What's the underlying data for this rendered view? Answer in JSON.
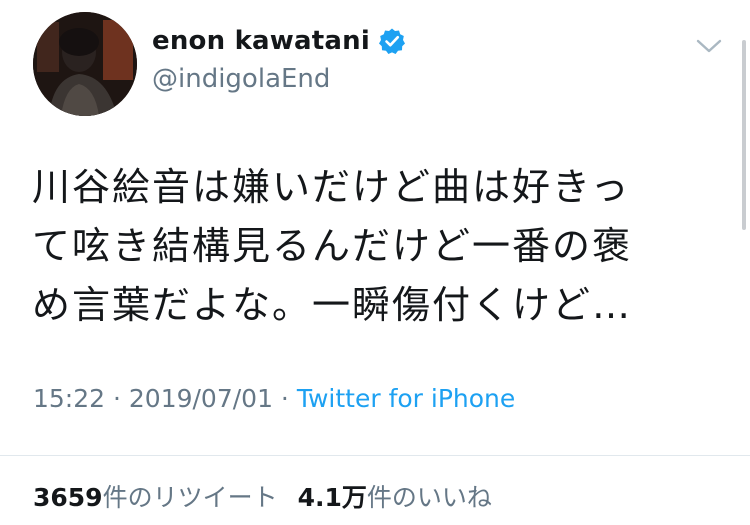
{
  "author": {
    "display_name": "enon kawatani",
    "handle": "@indigolaEnd",
    "verified": true,
    "avatar": "profile-photo"
  },
  "tweet": {
    "text": "川谷絵音は嫌いだけど曲は好きっ\nて呟き結構見るんだけど一番の褒\nめ言葉だよな。一瞬傷付くけど…"
  },
  "meta": {
    "time": "15:22",
    "separator1": " · ",
    "date": "2019/07/01",
    "separator2": " · ",
    "source": "Twitter for iPhone"
  },
  "stats": {
    "retweets_count": "3659",
    "retweets_label": "件のリツイート",
    "likes_count": "4.1万",
    "likes_label": "件のいいね"
  },
  "icons": {
    "menu": "chevron-down-icon",
    "verified": "verified-badge-icon"
  },
  "colors": {
    "verified_blue": "#1da1f2",
    "link_blue": "#1da1f2",
    "secondary_text": "#657786",
    "primary_text": "#14171a"
  }
}
